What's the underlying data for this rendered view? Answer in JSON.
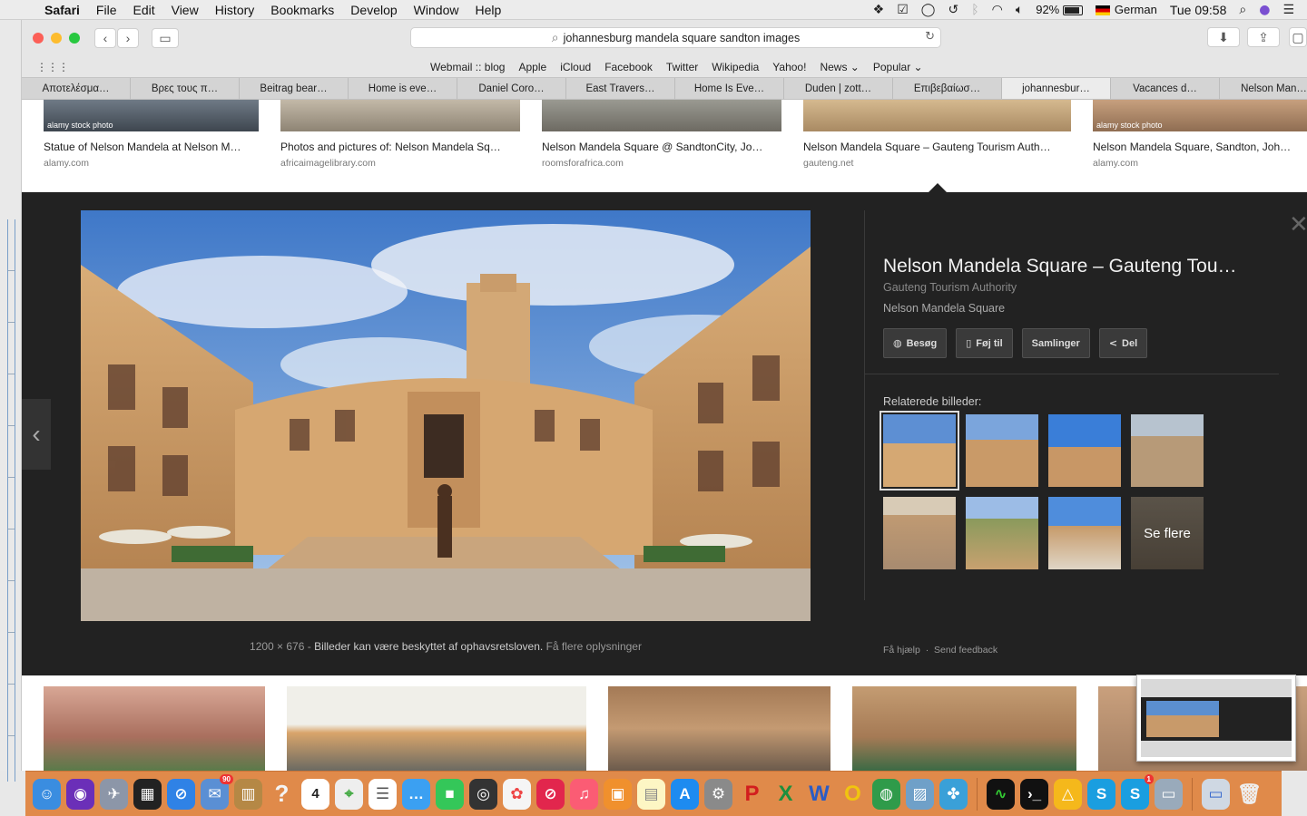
{
  "menubar": {
    "app": "Safari",
    "items": [
      "File",
      "Edit",
      "View",
      "History",
      "Bookmarks",
      "Develop",
      "Window",
      "Help"
    ],
    "battery": "92%",
    "input_source": "German",
    "clock": "Tue 09:58"
  },
  "toolbar": {
    "url": "johannesburg mandela square sandton images"
  },
  "favorites": [
    "Webmail :: blog",
    "Apple",
    "iCloud",
    "Facebook",
    "Twitter",
    "Wikipedia",
    "Yahoo!",
    "News ⌄",
    "Popular ⌄"
  ],
  "tabs": [
    {
      "label": "Αποτελέσμα…",
      "active": false
    },
    {
      "label": "Βρες τους π…",
      "active": false
    },
    {
      "label": "Beitrag bear…",
      "active": false
    },
    {
      "label": "Home is eve…",
      "active": false
    },
    {
      "label": "Daniel Coro…",
      "active": false
    },
    {
      "label": "East Travers…",
      "active": false
    },
    {
      "label": "Home Is Eve…",
      "active": false
    },
    {
      "label": "Duden | zott…",
      "active": false
    },
    {
      "label": "Επιβεβαίωσ…",
      "active": false
    },
    {
      "label": "johannesbur…",
      "active": true
    },
    {
      "label": "Vacances d…",
      "active": false
    },
    {
      "label": "Nelson Man…",
      "active": false
    }
  ],
  "top_results": [
    {
      "title": "Statue of Nelson Mandela at Nelson M…",
      "site": "alamy.com",
      "stock": "alamy stock photo"
    },
    {
      "title": "Photos and pictures of: Nelson Mandela Sq…",
      "site": "africaimagelibrary.com",
      "stock": ""
    },
    {
      "title": "Nelson Mandela Square @ SandtonCity, Jo…",
      "site": "roomsforafrica.com",
      "stock": ""
    },
    {
      "title": "Nelson Mandela Square – Gauteng Tourism Auth…",
      "site": "gauteng.net",
      "stock": ""
    },
    {
      "title": "Nelson Mandela Square, Sandton, Joh…",
      "site": "alamy.com",
      "stock": "alamy stock photo"
    }
  ],
  "viewer": {
    "title": "Nelson Mandela Square – Gauteng Tou…",
    "source": "Gauteng Tourism Authority",
    "description": "Nelson Mandela Square",
    "dimensions": "1200 × 676",
    "separator": " - ",
    "legal": "Billeder kan være beskyttet af ophavsretsloven.",
    "more_info": "Få flere oplysninger",
    "actions": [
      {
        "icon": "globe-icon",
        "glyph": "◍",
        "label": "Besøg"
      },
      {
        "icon": "bookmark-icon",
        "glyph": "▯",
        "label": "Føj til"
      },
      {
        "icon": "",
        "glyph": "",
        "label": "Samlinger"
      },
      {
        "icon": "share-icon",
        "glyph": "<",
        "label": "Del"
      }
    ],
    "related_label": "Relaterede billeder:",
    "see_more": "Se flere",
    "help": "Få hjælp",
    "feedback": "Send feedback"
  },
  "dock": {
    "mail_badge": "90",
    "calendar_day": "4",
    "skype_badge": "1"
  }
}
